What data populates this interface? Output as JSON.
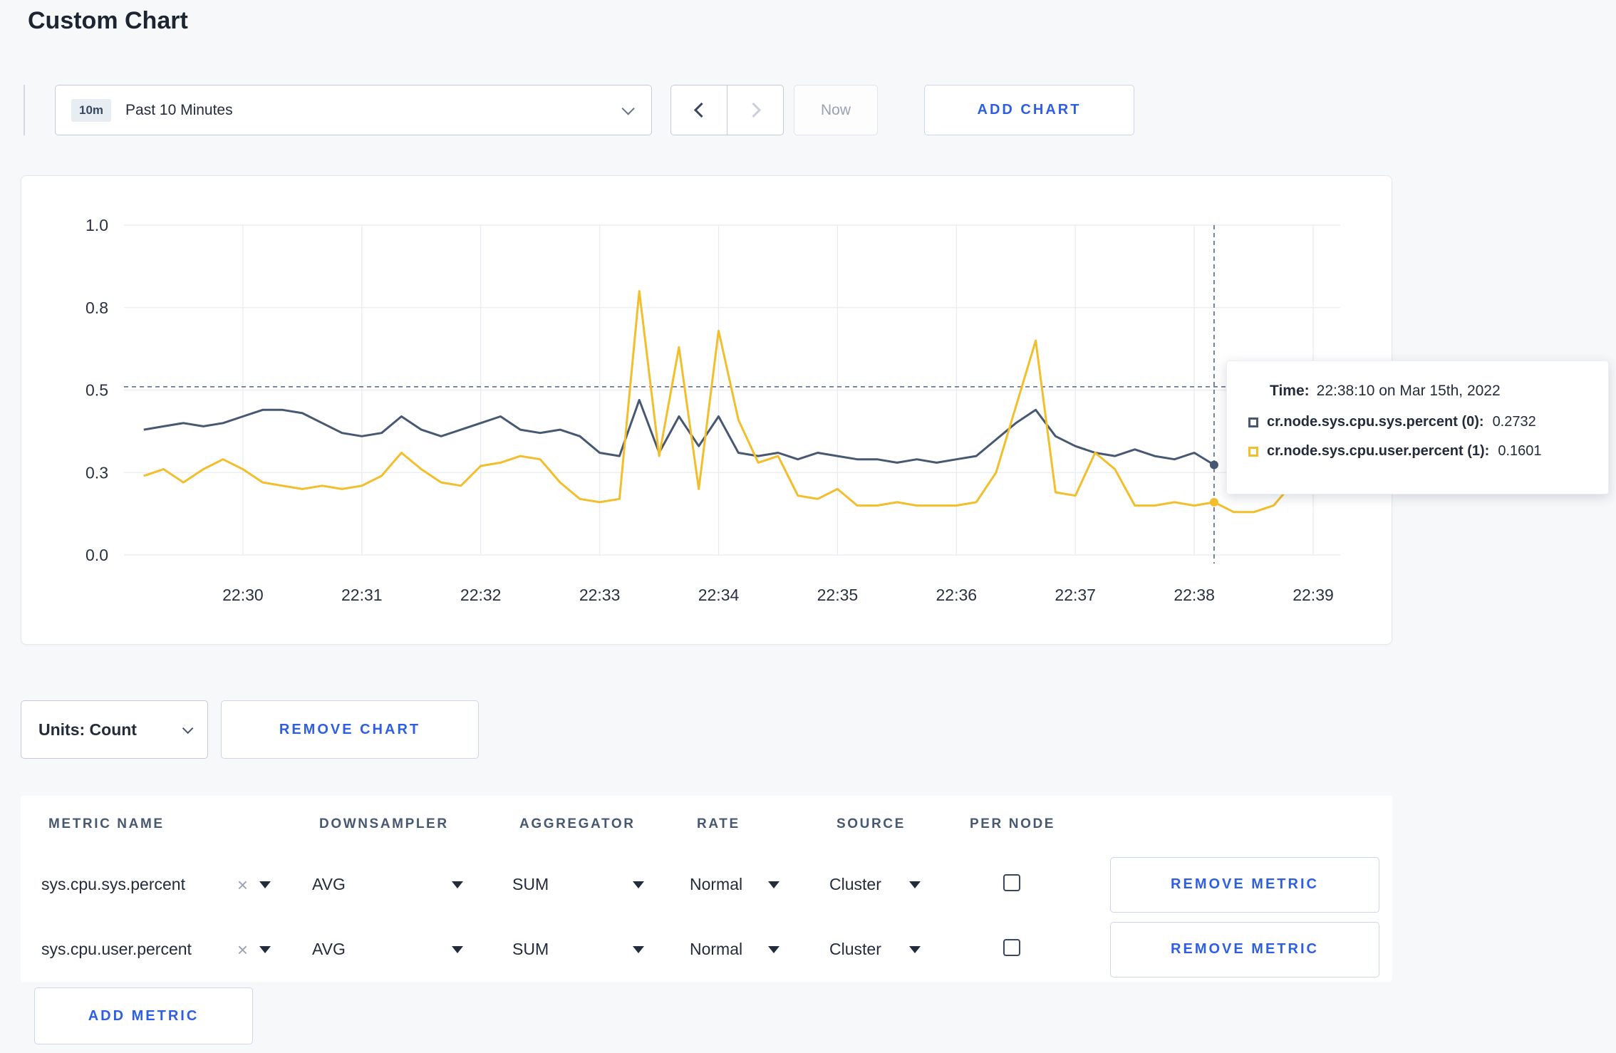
{
  "page": {
    "title": "Custom Chart"
  },
  "toolbar": {
    "time_range": {
      "badge": "10m",
      "label": "Past 10 Minutes"
    },
    "now_label": "Now",
    "add_chart_label": "ADD CHART"
  },
  "icons": {
    "clear": "×"
  },
  "chart": {
    "yticks": [
      {
        "value": 1.0,
        "label": "1.0"
      },
      {
        "value": 0.75,
        "label": "0.8"
      },
      {
        "value": 0.5,
        "label": "0.5"
      },
      {
        "value": 0.25,
        "label": "0.3"
      },
      {
        "value": 0.0,
        "label": "0.0"
      }
    ],
    "crosshair": {
      "time": "22:38:10",
      "seconds_from_origin": 550,
      "y_value": 0.51
    },
    "tooltip": {
      "time_label": "Time:",
      "time_value": "22:38:10 on Mar 15th, 2022",
      "series": [
        {
          "name": "cr.node.sys.cpu.sys.percent (0):",
          "value": "0.2732",
          "color": "#475872"
        },
        {
          "name": "cr.node.sys.cpu.user.percent (1):",
          "value": "0.1601",
          "color": "#F2BE2C"
        }
      ]
    }
  },
  "chart_data": {
    "type": "line",
    "ylim": [
      0,
      1
    ],
    "x_labels": [
      "22:30",
      "22:31",
      "22:32",
      "22:33",
      "22:34",
      "22:35",
      "22:36",
      "22:37",
      "22:38",
      "22:39"
    ],
    "x_origin": "22:29:00",
    "x_start_seconds": 10,
    "x_step_seconds": 10,
    "highlight_index": 54,
    "highlight_time": "22:38:10",
    "series": [
      {
        "name": "cr.node.sys.cpu.sys.percent",
        "key": "sys",
        "color": "#475872",
        "values": [
          0.38,
          0.39,
          0.4,
          0.39,
          0.4,
          0.42,
          0.44,
          0.44,
          0.43,
          0.4,
          0.37,
          0.36,
          0.37,
          0.42,
          0.38,
          0.36,
          0.38,
          0.4,
          0.42,
          0.38,
          0.37,
          0.38,
          0.36,
          0.31,
          0.3,
          0.47,
          0.31,
          0.42,
          0.33,
          0.42,
          0.31,
          0.3,
          0.31,
          0.29,
          0.31,
          0.3,
          0.29,
          0.29,
          0.28,
          0.29,
          0.28,
          0.29,
          0.3,
          0.35,
          0.4,
          0.44,
          0.36,
          0.33,
          0.31,
          0.3,
          0.32,
          0.3,
          0.29,
          0.31,
          0.2732
        ]
      },
      {
        "name": "cr.node.sys.cpu.user.percent",
        "key": "user",
        "color": "#F2BE2C",
        "values": [
          0.24,
          0.26,
          0.22,
          0.26,
          0.29,
          0.26,
          0.22,
          0.21,
          0.2,
          0.21,
          0.2,
          0.21,
          0.24,
          0.31,
          0.26,
          0.22,
          0.21,
          0.27,
          0.28,
          0.3,
          0.29,
          0.22,
          0.17,
          0.16,
          0.17,
          0.8,
          0.3,
          0.63,
          0.2,
          0.68,
          0.41,
          0.28,
          0.3,
          0.18,
          0.17,
          0.2,
          0.15,
          0.15,
          0.16,
          0.15,
          0.15,
          0.15,
          0.16,
          0.25,
          0.45,
          0.65,
          0.19,
          0.18,
          0.31,
          0.26,
          0.15,
          0.15,
          0.16,
          0.15,
          0.1601,
          0.13,
          0.13,
          0.15,
          0.22,
          0.28,
          0.24
        ]
      }
    ]
  },
  "controls": {
    "units_label": "Units: Count",
    "remove_chart_label": "REMOVE CHART",
    "add_metric_label": "ADD METRIC"
  },
  "metrics_table": {
    "headers": [
      "METRIC NAME",
      "DOWNSAMPLER",
      "AGGREGATOR",
      "RATE",
      "SOURCE",
      "PER NODE"
    ],
    "rows": [
      {
        "metric": "sys.cpu.sys.percent",
        "downsampler": "AVG",
        "aggregator": "SUM",
        "rate": "Normal",
        "source": "Cluster",
        "per_node": false,
        "remove_label": "REMOVE METRIC"
      },
      {
        "metric": "sys.cpu.user.percent",
        "downsampler": "AVG",
        "aggregator": "SUM",
        "rate": "Normal",
        "source": "Cluster",
        "per_node": false,
        "remove_label": "REMOVE METRIC"
      }
    ]
  }
}
